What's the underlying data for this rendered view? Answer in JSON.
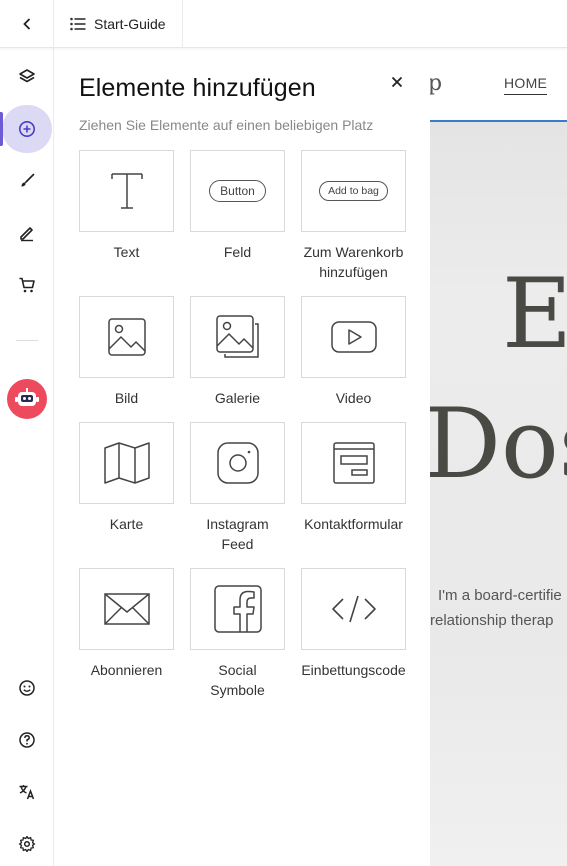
{
  "topbar": {
    "back_icon": "chevron-left-icon",
    "guide_label": "Start-Guide",
    "guide_icon": "list-icon"
  },
  "rail": {
    "items": [
      {
        "icon": "layers-icon"
      },
      {
        "icon": "add-circle-icon",
        "active": true
      },
      {
        "icon": "brush-icon"
      },
      {
        "icon": "pen-icon"
      },
      {
        "icon": "cart-icon"
      },
      {
        "icon": "robot-icon"
      },
      {
        "icon": "smiley-icon"
      },
      {
        "icon": "help-icon"
      },
      {
        "icon": "translate-icon"
      },
      {
        "icon": "settings-icon"
      }
    ],
    "accent": "#6b5bd6",
    "robot_color": "#ee4a5d"
  },
  "panel": {
    "title": "Elemente hinzufügen",
    "subtitle": "Ziehen Sie Elemente auf einen beliebigen Platz",
    "tiles": [
      {
        "label": "Text",
        "icon": "text-icon"
      },
      {
        "label": "Feld",
        "icon": "button-icon",
        "pill": "Button"
      },
      {
        "label": "Zum Warenkorb hinzufügen",
        "icon": "add-to-bag-icon",
        "pill": "Add to bag"
      },
      {
        "label": "Bild",
        "icon": "image-icon"
      },
      {
        "label": "Galerie",
        "icon": "gallery-icon"
      },
      {
        "label": "Video",
        "icon": "video-icon"
      },
      {
        "label": "Karte",
        "icon": "map-icon"
      },
      {
        "label": "Instagram Feed",
        "icon": "instagram-icon"
      },
      {
        "label": "Kontaktformular",
        "icon": "form-icon"
      },
      {
        "label": "Abonnieren",
        "icon": "envelope-icon"
      },
      {
        "label": "Social Symbole",
        "icon": "facebook-icon"
      },
      {
        "label": "Einbettungscode",
        "icon": "code-icon"
      }
    ]
  },
  "preview": {
    "logo_fragment": "p",
    "nav_home": "HOME",
    "hero_line1": "E",
    "hero_line2": "Dos",
    "intro_line1": "I'm a board-certifie",
    "intro_line2": "relationship therap",
    "accent_line": "#3b7dc4"
  }
}
